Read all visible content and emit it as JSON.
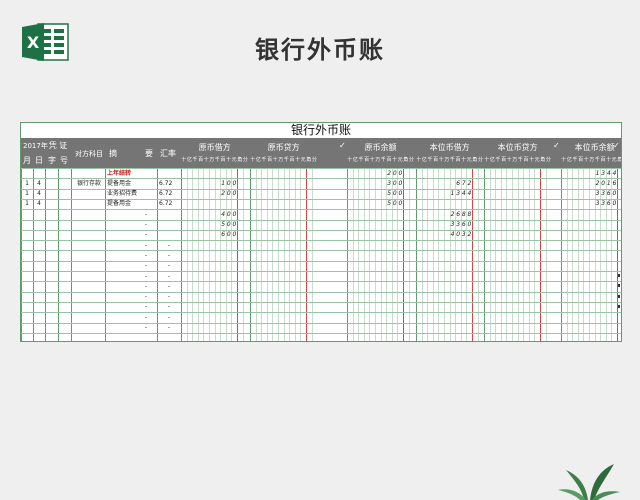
{
  "page_title": "银行外币账",
  "sheet": {
    "title": "银行外币账",
    "header": {
      "year": "2017年",
      "voucher": "凭 证",
      "month": "月",
      "day": "日",
      "type": "字",
      "number": "号",
      "counter_account": "对方科目",
      "summary_a": "摘",
      "summary_b": "要",
      "rate": "汇率",
      "groups": [
        "原币借方",
        "原币贷方",
        "原币余额",
        "本位币借方",
        "本位币贷方",
        "本位币余额"
      ],
      "check": "✓",
      "digit_labels": [
        "十",
        "亿",
        "千",
        "百",
        "十",
        "万",
        "千",
        "百",
        "十",
        "元",
        "角",
        "分"
      ]
    },
    "rows": [
      {
        "month": "",
        "day": "",
        "account": "",
        "summary": "上年结转",
        "rate": "",
        "balance": "200",
        "local_debit": "",
        "local_balance": "1344"
      },
      {
        "month": "1",
        "day": "4",
        "account": "银行存款",
        "summary": "提备用金",
        "rate": "6.72",
        "debit": "100",
        "balance": "300",
        "local_debit": "672",
        "local_balance": "2016"
      },
      {
        "month": "1",
        "day": "4",
        "account": "",
        "summary": "业务招待费",
        "rate": "6.72",
        "debit": "200",
        "balance": "500",
        "local_debit": "1344",
        "local_balance": "3360"
      },
      {
        "month": "1",
        "day": "4",
        "account": "",
        "summary": "提备用金",
        "rate": "6.72",
        "debit": "",
        "balance": "500",
        "local_debit": "",
        "local_balance": "3360"
      },
      {
        "summary": "-",
        "debit": "400",
        "local_debit": "2688"
      },
      {
        "summary": "-",
        "debit": "500",
        "local_debit": "3360"
      },
      {
        "summary": "-",
        "debit": "600",
        "local_debit": "4032"
      },
      {
        "summary": "-",
        "rate": "-"
      },
      {
        "summary": "-",
        "rate": "-"
      },
      {
        "summary": "-",
        "rate": "-"
      },
      {
        "summary": "-",
        "rate": "-"
      },
      {
        "summary": "-",
        "rate": "-"
      },
      {
        "summary": "-",
        "rate": "-"
      },
      {
        "summary": "-",
        "rate": "-"
      },
      {
        "summary": "-",
        "rate": "-"
      },
      {
        "summary": "-",
        "rate": "-"
      }
    ]
  },
  "icons": {
    "logo": "excel-icon",
    "plant": "plant-icon"
  },
  "colors": {
    "header_bg": "#757575",
    "grid": "#5f9b6f",
    "red_line": "#e04040",
    "logo": "#1e7145"
  }
}
